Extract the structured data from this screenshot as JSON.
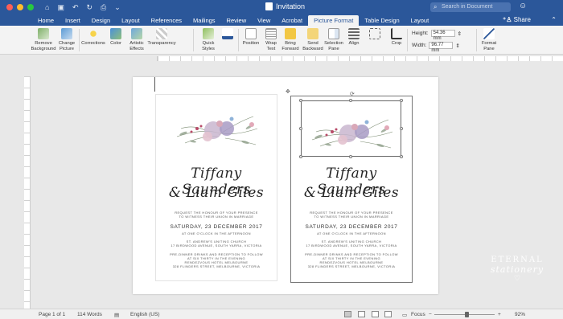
{
  "window": {
    "title": "Invitation",
    "search_placeholder": "Search in Document",
    "traffic_colors": [
      "#fc5f57",
      "#fdbc2e",
      "#28c840"
    ]
  },
  "tabs": [
    "Home",
    "Insert",
    "Design",
    "Layout",
    "References",
    "Mailings",
    "Review",
    "View",
    "Acrobat",
    "Picture Format",
    "Table Design",
    "Layout"
  ],
  "active_tab": "Picture Format",
  "share_label": "Share",
  "ribbon": {
    "remove_background": "Remove Background",
    "change_picture": "Change Picture",
    "corrections": "Corrections",
    "color": "Color",
    "artistic_effects": "Artistic Effects",
    "transparency": "Transparency",
    "quick_styles": "Quick Styles",
    "position": "Position",
    "wrap_text": "Wrap Text",
    "bring_forward": "Bring Forward",
    "send_backward": "Send Backward",
    "selection_pane": "Selection Pane",
    "align": "Align",
    "crop": "Crop",
    "height_label": "Height:",
    "height_value": "54.36 mm",
    "width_label": "Width:",
    "width_value": "96.77 mm",
    "format_pane": "Format Pane"
  },
  "invitation": {
    "name1": "Tiffany Saunders",
    "name2": "& Liam Giles",
    "request_line1": "REQUEST THE HONOUR OF YOUR PRESENCE",
    "request_line2": "TO WITNESS THEIR UNION IN MARRIAGE",
    "date": "SATURDAY, 23 DECEMBER 2017",
    "time": "AT ONE O'CLOCK IN THE AFTERNOON",
    "venue1": "ST. ANDREW'S UNITING CHURCH",
    "venue2": "17 BIRDWOOD AVENUE, SOUTH YARRA, VICTORIA",
    "dinner1": "PRE-DINNER DRINKS AND RECEPTION TO FOLLOW",
    "dinner2": "AT SIX THIRTY IN THE EVENING",
    "dinner3": "RENDEZVOUS HOTEL MELBOURNE",
    "dinner4": "328 FLINDERS STREET, MELBOURNE, VICTORIA"
  },
  "watermark": {
    "line1": "ETERNAL",
    "line2": "stationery"
  },
  "status": {
    "page": "Page 1 of 1",
    "words": "114 Words",
    "language": "English (US)",
    "focus": "Focus",
    "zoom": "92%"
  }
}
